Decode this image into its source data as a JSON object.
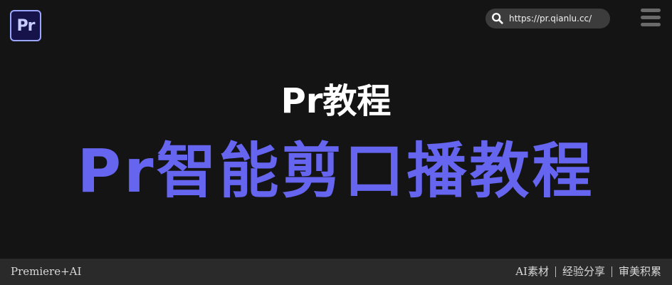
{
  "logo": {
    "text": "Pr"
  },
  "search": {
    "url": "https://pr.qianlu.cc/"
  },
  "hero": {
    "subtitle": "Pr教程",
    "title": "Pr智能剪口播教程"
  },
  "footer": {
    "left": "Premiere+AI",
    "tags": [
      "AI素材",
      "经验分享",
      "审美积累"
    ]
  },
  "colors": {
    "background": "#151415",
    "accent": "#6565f0",
    "footer_bg": "#2a2a2a",
    "logo_bg": "#15134a",
    "logo_border": "#9aa5ff"
  },
  "icons": {
    "logo": "premiere-pro-logo",
    "search": "search-icon",
    "menu": "hamburger-menu-icon"
  }
}
